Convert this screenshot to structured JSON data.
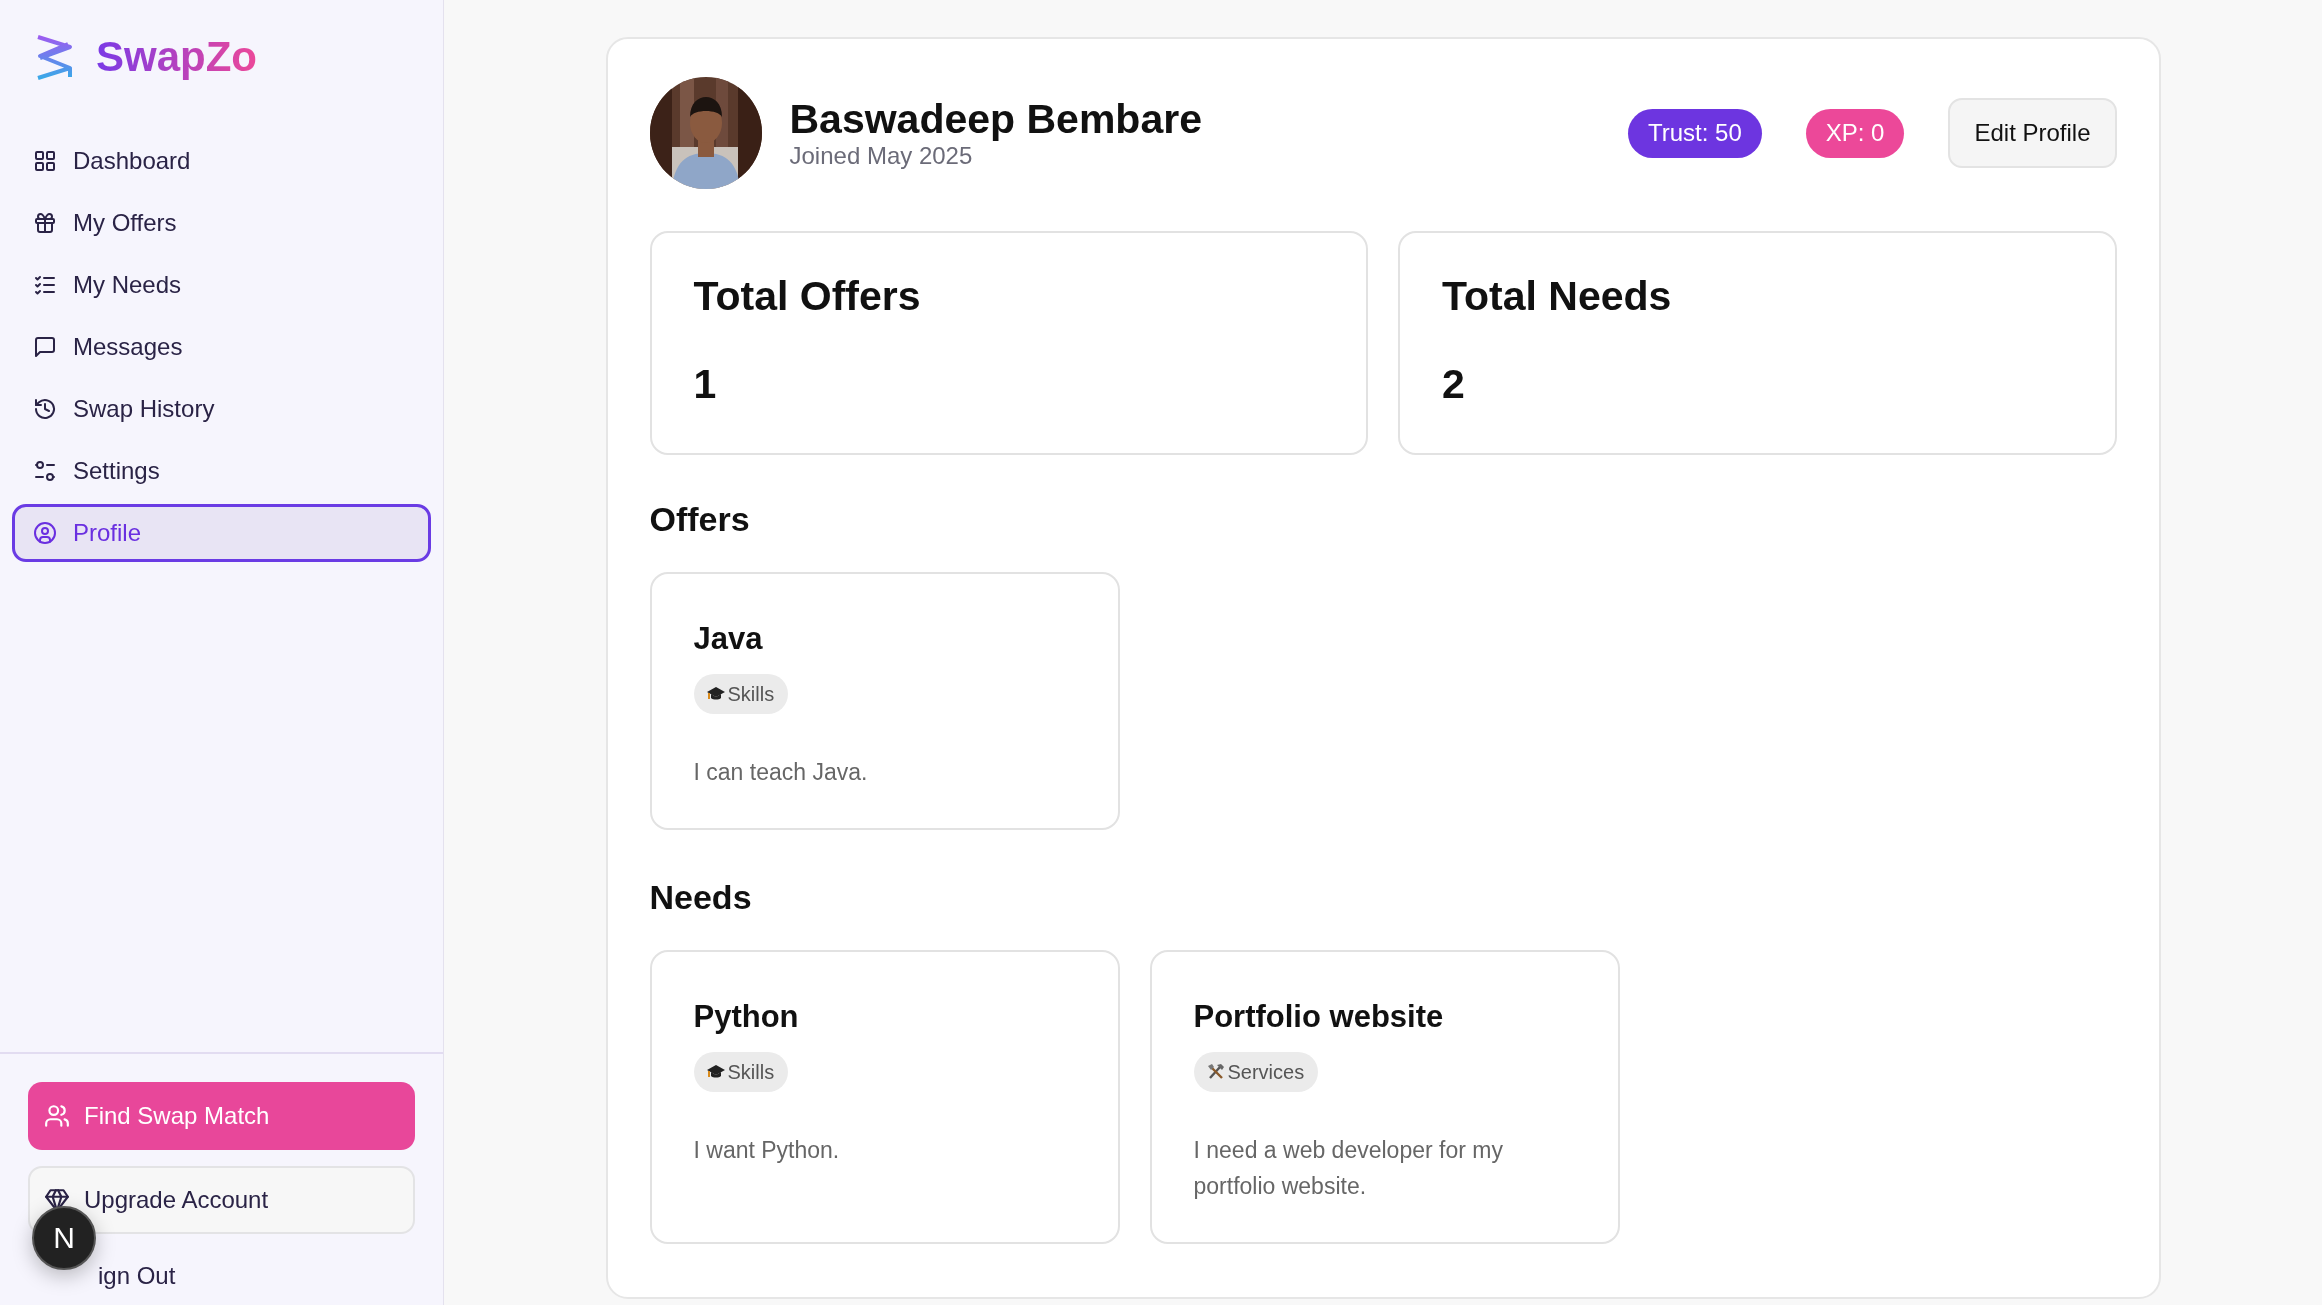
{
  "sidebar": {
    "logo": "SwapZo",
    "nav": [
      {
        "label": "Dashboard",
        "selected": false
      },
      {
        "label": "My Offers",
        "selected": false
      },
      {
        "label": "My Needs",
        "selected": false
      },
      {
        "label": "Messages",
        "selected": false
      },
      {
        "label": "Swap History",
        "selected": false
      },
      {
        "label": "Settings",
        "selected": false
      },
      {
        "label": "Profile",
        "selected": true
      }
    ],
    "actions": [
      {
        "label": "Find Swap Match",
        "kind": "primary"
      },
      {
        "label": "Upgrade Account",
        "kind": "outline"
      }
    ],
    "sign_out": "ign Out"
  },
  "dev_badge": "N",
  "profile": {
    "name": "Baswadeep Bembare",
    "joined": "Joined May 2025",
    "badges": [
      {
        "label": "Trust: 50",
        "color": "#6d35e0"
      },
      {
        "label": "XP: 0",
        "color": "#ec4899"
      }
    ],
    "edit_button": "Edit Profile"
  },
  "stats": [
    {
      "title": "Total Offers",
      "value": "1"
    },
    {
      "title": "Total Needs",
      "value": "2"
    }
  ],
  "offers": {
    "heading": "Offers",
    "items": [
      {
        "title": "Java",
        "tag": {
          "kind": "skills",
          "label": "Skills"
        },
        "description": "I can teach Java."
      }
    ]
  },
  "needs": {
    "heading": "Needs",
    "items": [
      {
        "title": "Python",
        "tag": {
          "kind": "skills",
          "label": "Skills"
        },
        "description": "I want Python."
      },
      {
        "title": "Portfolio website",
        "tag": {
          "kind": "services",
          "label": "Services"
        },
        "description": "I need a web developer for my portfolio website."
      }
    ]
  }
}
